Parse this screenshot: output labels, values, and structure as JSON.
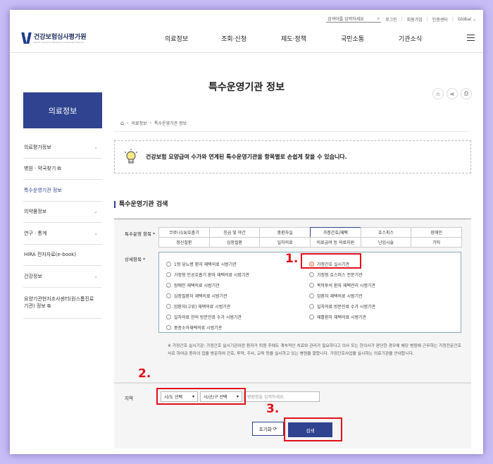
{
  "util_bar": {
    "search_placeholder": "검색어를 입력하세요",
    "links": [
      "로그인",
      "회원가입",
      "인증센터",
      "Global"
    ]
  },
  "logo": {
    "name": "건강보험심사평가원",
    "sub": "Health Insurance Review & Assessment Service"
  },
  "gnb": [
    "의료정보",
    "조회·신청",
    "제도·정책",
    "국민소통",
    "기관소식"
  ],
  "page_title": "특수운영기관 정보",
  "sidebar": {
    "title": "의료정보",
    "items": [
      {
        "label": "의료평가정보",
        "chevron": true
      },
      {
        "label": "병원 · 약국찾기 ⧉",
        "chevron": false
      },
      {
        "label": "특수운영기관 정보",
        "chevron": false
      },
      {
        "label": "의약품정보",
        "chevron": true
      },
      {
        "label": "연구 · 통계",
        "chevron": true
      },
      {
        "label": "HIRA 전자자료(e-book)",
        "chevron": false
      },
      {
        "label": "건강정보",
        "chevron": true
      },
      {
        "label": "요양기관현지조사센터(원스톱진료기관) 정보 ⧉",
        "chevron": false
      }
    ]
  },
  "breadcrumb": [
    "의료정보",
    "특수운영기관 정보"
  ],
  "info_text": "건강보험 요양급여 수가와 연계된 특수운영기관을 항목별로 손쉽게 찾을 수 있습니다.",
  "section_title": "특수운영기관 검색",
  "form": {
    "type_label": "특수운영 항목 *",
    "types_row1": [
      "코로나19/호흡기",
      "응급 및 야간",
      "중환자실",
      "가정간호/재택",
      "호스피스",
      "장애인"
    ],
    "types_row2": [
      "정신질환",
      "심장질환",
      "일차의료",
      "의료급여 등 의료지원",
      "난임시술",
      "기타"
    ],
    "detail_label": "상세항목 *",
    "details_left": [
      "1형 당뇨병 환자 재택의료 시범기관",
      "가정형 인공호흡기 환자 재택의료 시범기관",
      "장애인 재택의료 시범기관",
      "심장질환자 재택의료 시범기관",
      "암환자(고위) 재택의료 시범기관",
      "일차의료 한의 방문진료 수가 시범기관",
      "중증소아재택의료 시범기관"
    ],
    "details_right": [
      "가정간호 실시기관",
      "가정형 호스피스 전문기관",
      "복막투석 환자 재택관리 시범기관",
      "암환자 재택의료 시범기관",
      "일차의료 방문진료 수가 시범기관",
      "재활환자 재택의료 시범기관"
    ],
    "note": "※ 가정간호 실시기관: 가정간호 실시기관이란 환자가 퇴원 후에도 계속적인 치료와 관리가 필요하다고 의사 또는 한의사가 판단한 경우에 해당 병원에 근무하는 가정전문간호사로 하여금 환자의 집을 방문하여 간호, 투약, 주사, 교육 등을 실시하고 있는 병원을 말합니다. 가정간호사업을 실시하는 의료기관을 안내합니다.",
    "region_label": "지역",
    "sido": "시/도 선택",
    "sigungu": "시/군/구 선택",
    "hospital_placeholder": "병원명을 입력하세요.",
    "reset_label": "초기화",
    "search_label": "검색"
  },
  "annotations": [
    "1.",
    "2.",
    "3."
  ],
  "colors": {
    "primary": "#2f4390",
    "highlight": "#e3101a",
    "background": "#c8bdf6"
  }
}
